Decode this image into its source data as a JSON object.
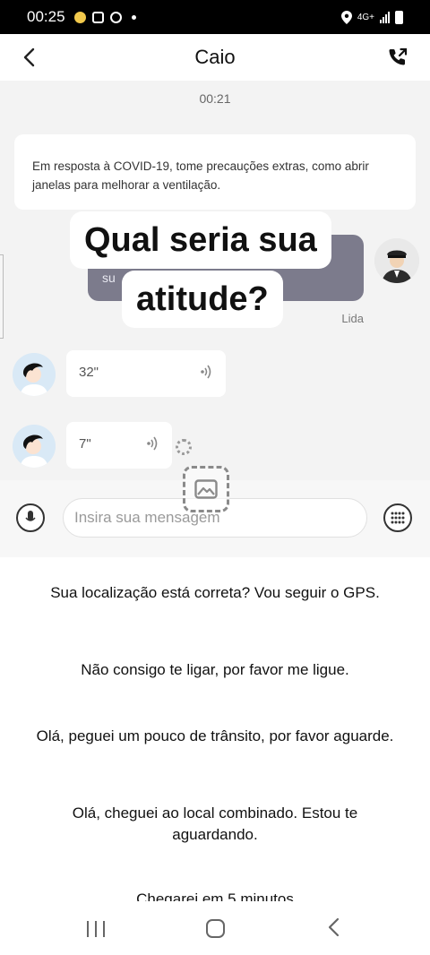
{
  "status_bar": {
    "time": "00:25",
    "network": "4G+",
    "left_icons": [
      "notification-icon",
      "screenshot-icon",
      "assistant-icon"
    ],
    "right_icons": [
      "location-icon",
      "signal-icon",
      "battery-icon"
    ]
  },
  "header": {
    "title": "Caio",
    "back_icon": "chevron-left-icon",
    "call_icon": "phone-call-icon"
  },
  "chat": {
    "timer": "00:21",
    "notice": "Em resposta à COVID-19, tome precauções extras, como abrir janelas para melhorar a ventilação.",
    "sent_partial_text": "su",
    "read_status": "Lida",
    "overlay": {
      "line1": "Qual seria sua",
      "line2": "atitude?"
    },
    "voice_messages": [
      {
        "duration": "32\""
      },
      {
        "duration": "7\""
      }
    ]
  },
  "input_bar": {
    "placeholder": "Insira sua mensagem"
  },
  "quick_replies": [
    "Sua localização está correta? Vou seguir o GPS.",
    "Não consigo te ligar, por favor me ligue.",
    "Olá, peguei um pouco de trânsito, por favor aguarde.",
    "Olá, cheguei ao local combinado. Estou te aguardando.",
    "Chegarei em 5 minutos"
  ],
  "colors": {
    "chat_background": "#f3f3f3",
    "sent_bubble": "#7c7b8c",
    "avatar_customer_bg": "#d9e9f6"
  }
}
